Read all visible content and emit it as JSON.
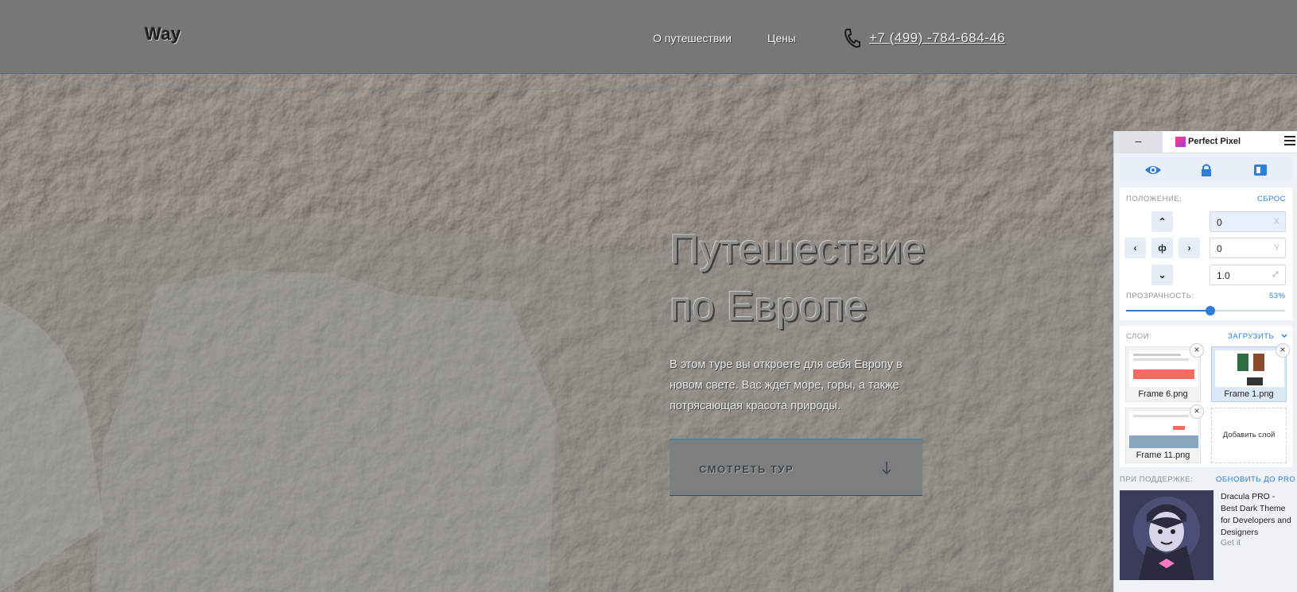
{
  "header": {
    "logo": "Way",
    "nav": [
      "О путешествии",
      "Цены"
    ],
    "phone": "+7 (499) -784-684-46"
  },
  "hero": {
    "title_line1": "Путешествие",
    "title_line2": "по Европе",
    "description": "В этом туре вы откроете для себя Европу в новом свете. Вас ждет море, горы, а также потрясающая красота природы.",
    "cta_label": "СМОТРЕТЬ ТУР"
  },
  "perfect_pixel": {
    "minimize": "–",
    "title": "Perfect Pixel",
    "position_label": "ПОЛОЖЕНИЕ:",
    "reset_label": "СБРОС",
    "center_symbol": "ф",
    "x_value": "0",
    "x_suffix": "X",
    "y_value": "0",
    "y_suffix": "Y",
    "scale_value": "1.0",
    "opacity_label": "ПРОЗРАЧНОСТЬ:",
    "opacity_value": "53%",
    "opacity_fraction": 0.53,
    "layers_label": "СЛОИ:",
    "upload_label": "ЗАГРУЗИТЬ",
    "layers": [
      {
        "name": "Frame 6.png",
        "active": false
      },
      {
        "name": "Frame 1.png",
        "active": true
      },
      {
        "name": "Frame 11.png",
        "active": false
      }
    ],
    "add_layer_label": "Добавить слой",
    "support_label": "ПРИ ПОДДЕРЖКЕ:",
    "upgrade_label": "ОБНОВИТЬ ДО PRO",
    "ad_title": "Dracula PRO - Best Dark Theme for Developers and Designers",
    "ad_link": "Get it"
  },
  "colors": {
    "accent": "#2d7fd9",
    "cta_border": "#3e8aa8"
  }
}
